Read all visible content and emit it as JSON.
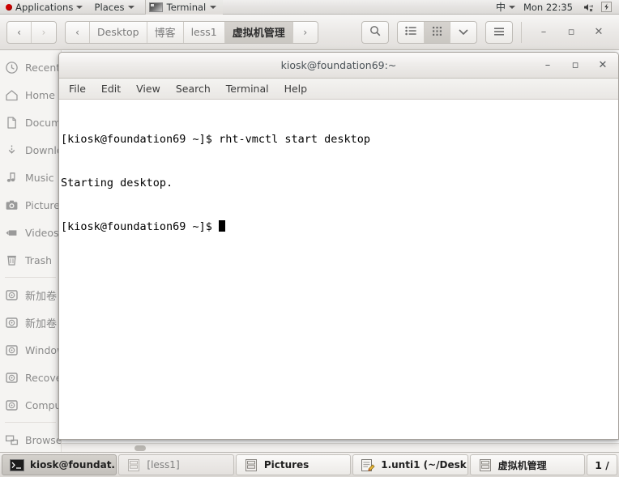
{
  "top_panel": {
    "applications_label": "Applications",
    "places_label": "Places",
    "window_list_label": "Terminal",
    "ime_label": "中",
    "clock": "Mon 22:35",
    "tray": [
      {
        "name": "volume-muted-icon"
      },
      {
        "name": "power-icon"
      }
    ]
  },
  "file_manager": {
    "nav": {
      "back_label": "‹",
      "forward_label": "›"
    },
    "breadcrumb": {
      "prev_label": "‹",
      "next_label": "›",
      "items": [
        {
          "label": "Desktop",
          "active": false,
          "cjk": false
        },
        {
          "label": "博客",
          "active": false,
          "cjk": true
        },
        {
          "label": "less1",
          "active": false,
          "cjk": false
        },
        {
          "label": "虚拟机管理",
          "active": true,
          "cjk": true
        }
      ]
    },
    "toolbar": {
      "search_label": "search-icon",
      "list_view_label": "list-view-icon",
      "grid_view_label": "grid-view-icon",
      "view_dropdown_label": "chevron-down-icon",
      "menu_label": "hamburger-menu-icon",
      "minimize_label": "–",
      "maximize_label": "▫",
      "close_label": "✕"
    },
    "sidebar": {
      "items": [
        {
          "label": "Recent",
          "icon": "clock-icon",
          "cjk": false
        },
        {
          "label": "Home",
          "icon": "home-icon",
          "cjk": false
        },
        {
          "label": "Documents",
          "icon": "document-icon",
          "cjk": false
        },
        {
          "label": "Downloads",
          "icon": "download-icon",
          "cjk": false
        },
        {
          "label": "Music",
          "icon": "music-icon",
          "cjk": false
        },
        {
          "label": "Pictures",
          "icon": "camera-icon",
          "cjk": false
        },
        {
          "label": "Videos",
          "icon": "video-icon",
          "cjk": false
        },
        {
          "label": "Trash",
          "icon": "trash-icon",
          "cjk": false
        },
        {
          "label": "新加卷",
          "icon": "drive-icon",
          "cjk": true
        },
        {
          "label": "新加卷",
          "icon": "drive-icon",
          "cjk": true
        },
        {
          "label": "Windows",
          "icon": "drive-icon",
          "cjk": false
        },
        {
          "label": "Recovery",
          "icon": "drive-icon",
          "cjk": false
        },
        {
          "label": "Computer",
          "icon": "drive-icon",
          "cjk": false
        },
        {
          "label": "Browse Network",
          "icon": "network-icon",
          "cjk": false
        }
      ]
    }
  },
  "terminal": {
    "title": "kiosk@foundation69:~",
    "window_buttons": {
      "minimize": "–",
      "maximize": "▫",
      "close": "✕"
    },
    "menu": [
      "File",
      "Edit",
      "View",
      "Search",
      "Terminal",
      "Help"
    ],
    "lines": [
      "[kiosk@foundation69 ~]$ rht-vmctl start desktop",
      "Starting desktop.",
      "[kiosk@foundation69 ~]$ "
    ]
  },
  "taskbar": {
    "items": [
      {
        "label": "kiosk@foundat...",
        "icon": "terminal-icon",
        "state": "active"
      },
      {
        "label": "[less1]",
        "icon": "files-icon",
        "state": "inactive"
      },
      {
        "label": "Pictures",
        "icon": "files-icon",
        "state": "normal"
      },
      {
        "label": "1.unti1 (~/Desk...",
        "icon": "texteditor-icon",
        "state": "normal"
      },
      {
        "label": "虚拟机管理",
        "icon": "files-icon",
        "state": "normal"
      }
    ],
    "workspace_indicator": "1 /"
  },
  "colors": {
    "panel_bg": "#e4e2e0",
    "window_chrome": "#ebe9e7",
    "terminal_bg": "#ffffff",
    "terminal_fg": "#000000",
    "accent_active": "#d6d3cf",
    "sidebar_bg": "#f5f4f2",
    "title_fg": "#4a5257"
  }
}
